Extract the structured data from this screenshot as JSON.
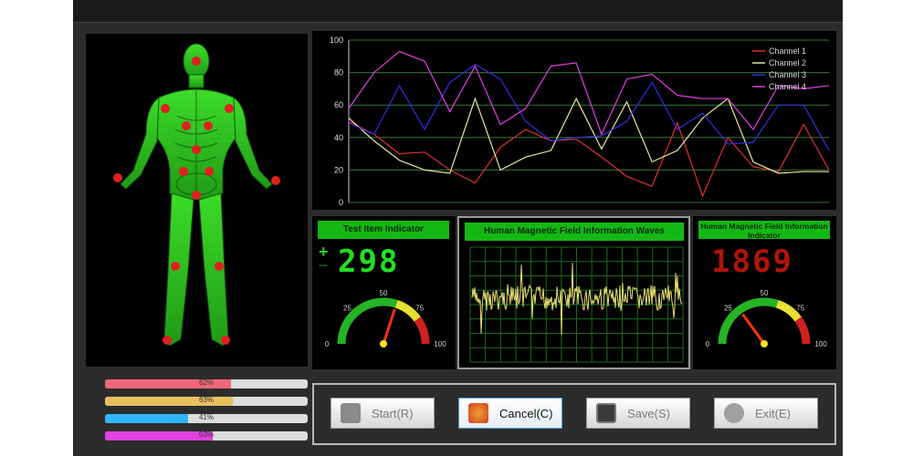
{
  "indicators": {
    "test_item": {
      "title": "Test Item Indicator",
      "value": "298",
      "sign": "+",
      "gauge_ticks": [
        "0",
        "25",
        "50",
        "75",
        "100"
      ],
      "gauge_value": 60
    },
    "field": {
      "title": "Human Magnetic Field Information Indicator",
      "value": "1869",
      "gauge_ticks": [
        "0",
        "25",
        "50",
        "75",
        "100"
      ],
      "gauge_value": 30
    }
  },
  "waves": {
    "title": "Human Magnetic Field Information Waves"
  },
  "progress": [
    {
      "label": "62%",
      "value": 62,
      "color": "#f06878"
    },
    {
      "label": "63%",
      "value": 63,
      "color": "#e8c060"
    },
    {
      "label": "41%",
      "value": 41,
      "color": "#30b4ff"
    },
    {
      "label": "53%",
      "value": 53,
      "color": "#e040e0"
    }
  ],
  "buttons": {
    "start": "Start(R)",
    "cancel": "Cancel(C)",
    "save": "Save(S)",
    "exit": "Exit(E)"
  },
  "chart_data": {
    "type": "line",
    "x": [
      1,
      2,
      3,
      4,
      5,
      6,
      7,
      8,
      9,
      10,
      11,
      12,
      13,
      14,
      15,
      16,
      17,
      18,
      19,
      20
    ],
    "ylim": [
      0,
      100
    ],
    "yticks": [
      0,
      20,
      40,
      60,
      80,
      100
    ],
    "grid": true,
    "legend": "top-right",
    "series": [
      {
        "name": "Channel 1",
        "color": "#e03030",
        "values": [
          50,
          42,
          30,
          31,
          20,
          12,
          34,
          45,
          38,
          39,
          28,
          16,
          10,
          49,
          4,
          40,
          22,
          19,
          48,
          20
        ]
      },
      {
        "name": "Channel 2",
        "color": "#e8e8a0",
        "values": [
          52,
          38,
          26,
          20,
          18,
          64,
          20,
          28,
          32,
          64,
          33,
          62,
          25,
          32,
          52,
          64,
          25,
          18,
          19,
          19
        ]
      },
      {
        "name": "Channel 3",
        "color": "#3030e0",
        "values": [
          49,
          42,
          72,
          45,
          74,
          85,
          76,
          50,
          38,
          40,
          41,
          50,
          74,
          45,
          55,
          36,
          37,
          60,
          60,
          32
        ]
      },
      {
        "name": "Channel 4",
        "color": "#e040e0",
        "values": [
          58,
          80,
          93,
          87,
          56,
          84,
          48,
          58,
          84,
          86,
          42,
          76,
          79,
          66,
          64,
          64,
          45,
          72,
          70,
          72
        ]
      }
    ]
  }
}
